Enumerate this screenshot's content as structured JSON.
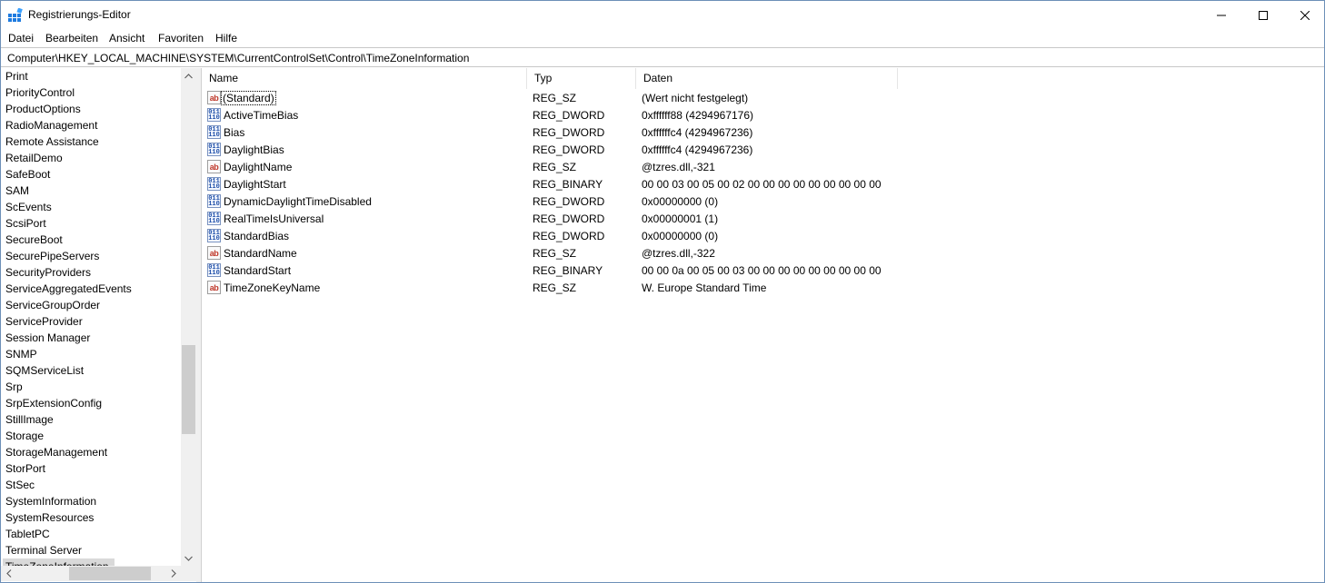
{
  "window": {
    "title": "Registrierungs-Editor",
    "app_icon": "regedit-icon"
  },
  "menu": [
    "Datei",
    "Bearbeiten",
    "Ansicht",
    "Favoriten",
    "Hilfe"
  ],
  "address": "Computer\\HKEY_LOCAL_MACHINE\\SYSTEM\\CurrentControlSet\\Control\\TimeZoneInformation",
  "tree": {
    "items": [
      "Print",
      "PriorityControl",
      "ProductOptions",
      "RadioManagement",
      "Remote Assistance",
      "RetailDemo",
      "SafeBoot",
      "SAM",
      "ScEvents",
      "ScsiPort",
      "SecureBoot",
      "SecurePipeServers",
      "SecurityProviders",
      "ServiceAggregatedEvents",
      "ServiceGroupOrder",
      "ServiceProvider",
      "Session Manager",
      "SNMP",
      "SQMServiceList",
      "Srp",
      "SrpExtensionConfig",
      "StillImage",
      "Storage",
      "StorageManagement",
      "StorPort",
      "StSec",
      "SystemInformation",
      "SystemResources",
      "TabletPC",
      "Terminal Server",
      "TimeZoneInformation"
    ],
    "selected": "TimeZoneInformation"
  },
  "columns": {
    "name": "Name",
    "type": "Typ",
    "data": "Daten"
  },
  "values": [
    {
      "icon": "string-value-icon",
      "name": "(Standard)",
      "type": "REG_SZ",
      "data": "(Wert nicht festgelegt)"
    },
    {
      "icon": "binary-value-icon",
      "name": "ActiveTimeBias",
      "type": "REG_DWORD",
      "data": "0xffffff88 (4294967176)"
    },
    {
      "icon": "binary-value-icon",
      "name": "Bias",
      "type": "REG_DWORD",
      "data": "0xffffffc4 (4294967236)"
    },
    {
      "icon": "binary-value-icon",
      "name": "DaylightBias",
      "type": "REG_DWORD",
      "data": "0xffffffc4 (4294967236)"
    },
    {
      "icon": "string-value-icon",
      "name": "DaylightName",
      "type": "REG_SZ",
      "data": "@tzres.dll,-321"
    },
    {
      "icon": "binary-value-icon",
      "name": "DaylightStart",
      "type": "REG_BINARY",
      "data": "00 00 03 00 05 00 02 00 00 00 00 00 00 00 00 00"
    },
    {
      "icon": "binary-value-icon",
      "name": "DynamicDaylightTimeDisabled",
      "type": "REG_DWORD",
      "data": "0x00000000 (0)"
    },
    {
      "icon": "binary-value-icon",
      "name": "RealTimeIsUniversal",
      "type": "REG_DWORD",
      "data": "0x00000001 (1)"
    },
    {
      "icon": "binary-value-icon",
      "name": "StandardBias",
      "type": "REG_DWORD",
      "data": "0x00000000 (0)"
    },
    {
      "icon": "string-value-icon",
      "name": "StandardName",
      "type": "REG_SZ",
      "data": "@tzres.dll,-322"
    },
    {
      "icon": "binary-value-icon",
      "name": "StandardStart",
      "type": "REG_BINARY",
      "data": "00 00 0a 00 05 00 03 00 00 00 00 00 00 00 00 00"
    },
    {
      "icon": "string-value-icon",
      "name": "TimeZoneKeyName",
      "type": "REG_SZ",
      "data": "W. Europe Standard Time"
    }
  ],
  "icons": {
    "string_glyph": "ab",
    "binary_glyph_top": "011",
    "binary_glyph_bottom": "110"
  }
}
